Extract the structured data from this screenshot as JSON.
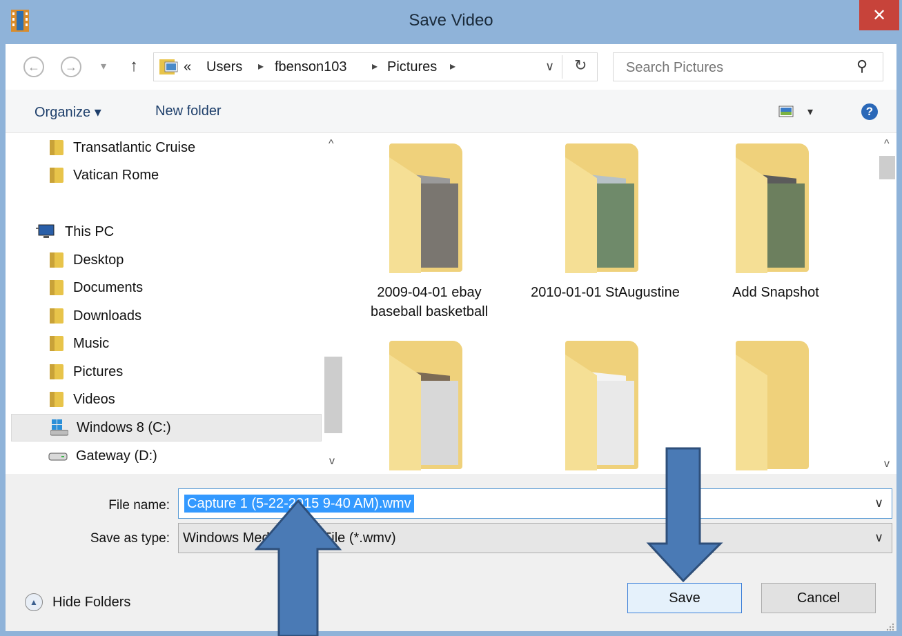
{
  "window": {
    "title": "Save Video",
    "close_glyph": "✕"
  },
  "nav": {
    "back_icon": "arrow-left-icon",
    "forward_icon": "arrow-right-icon",
    "up_icon": "arrow-up-icon",
    "back_glyph": "←",
    "forward_glyph": "→",
    "recent_glyph": "▾",
    "up_glyph": "↑",
    "overflow": "«",
    "breadcrumbs": [
      "Users",
      "fbenson103",
      "Pictures"
    ],
    "crumb_sep": "▸",
    "dropdown_glyph": "∨",
    "refresh_glyph": "↻",
    "search_placeholder": "Search Pictures",
    "search_glyph": "⚲"
  },
  "toolbar": {
    "organize": "Organize ▾",
    "new_folder": "New folder",
    "view_caret": "▾",
    "help_glyph": "?"
  },
  "sidebar": {
    "scroll_up": "^",
    "scroll_down": "v",
    "items": [
      {
        "label": "Transatlantic Cruise",
        "icon": "folder-icon"
      },
      {
        "label": "Vatican Rome",
        "icon": "folder-icon"
      },
      {
        "label": "This PC",
        "icon": "computer-icon"
      },
      {
        "label": "Desktop",
        "icon": "desktop-folder-icon"
      },
      {
        "label": "Documents",
        "icon": "documents-folder-icon"
      },
      {
        "label": "Downloads",
        "icon": "downloads-folder-icon"
      },
      {
        "label": "Music",
        "icon": "music-folder-icon"
      },
      {
        "label": "Pictures",
        "icon": "pictures-folder-icon"
      },
      {
        "label": "Videos",
        "icon": "videos-folder-icon"
      },
      {
        "label": "Windows 8 (C:)",
        "icon": "windows-drive-icon",
        "selected": true
      },
      {
        "label": "Gateway (D:)",
        "icon": "drive-icon"
      }
    ]
  },
  "content": {
    "scroll_up": "^",
    "scroll_down": "v",
    "folders": [
      {
        "label": "2009-04-01 ebay baseball basketball"
      },
      {
        "label": "2010-01-01 StAugustine"
      },
      {
        "label": "Add Snapshot"
      },
      {
        "label": ""
      },
      {
        "label": ""
      },
      {
        "label": ""
      }
    ]
  },
  "form": {
    "file_name_label": "File name:",
    "file_name_value": "Capture 1 (5-22-2015 9-40 AM).wmv",
    "save_type_label": "Save as type:",
    "save_type_value": "Windows Media Video File (*.wmv)",
    "dropdown_glyph": "∨",
    "hide_folders": "Hide Folders",
    "hide_glyph": "▲",
    "save": "Save",
    "cancel": "Cancel"
  },
  "colors": {
    "frame": "#8fb3d9",
    "close": "#c7433a",
    "selection": "#3399ff",
    "annotation_arrow": "#4a7ab5"
  }
}
